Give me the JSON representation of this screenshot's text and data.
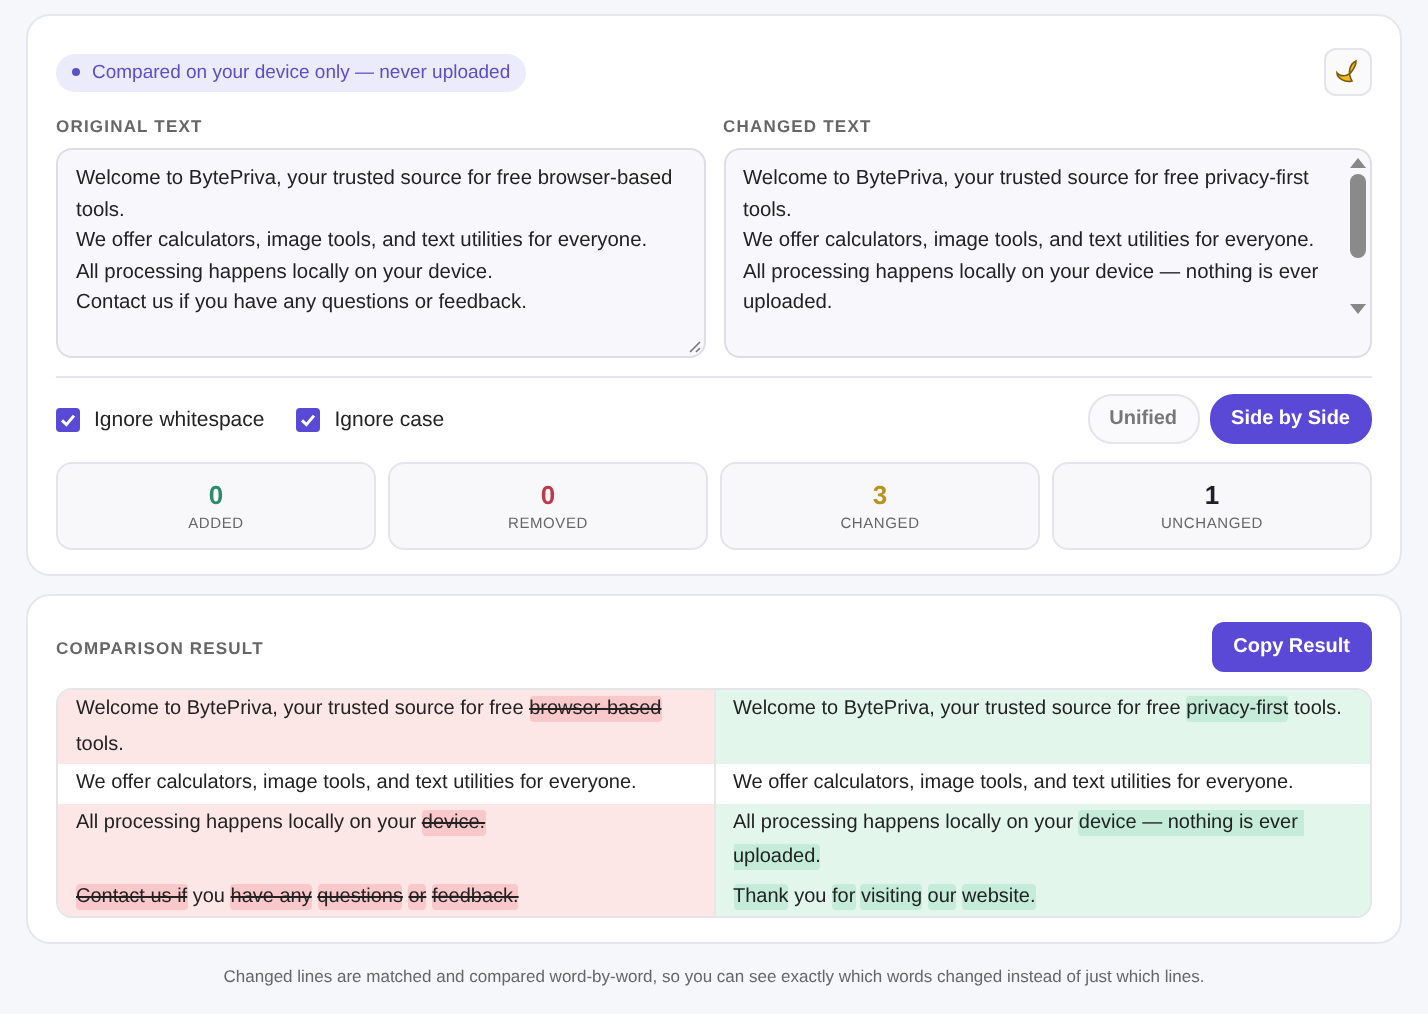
{
  "privacy_badge": "Compared on your device only — never uploaded",
  "original": {
    "label": "ORIGINAL TEXT",
    "lines": [
      "Welcome to BytePriva, your trusted source for free browser-based tools.",
      "We offer calculators, image tools, and text utilities for everyone.",
      "All processing happens locally on your device.",
      "Contact us if you have any questions or feedback."
    ]
  },
  "changed": {
    "label": "CHANGED TEXT",
    "lines": [
      "Welcome to BytePriva, your trusted source for free privacy-first tools.",
      "We offer calculators, image tools, and text utilities for everyone.",
      "All processing happens locally on your device — nothing is ever uploaded."
    ]
  },
  "options": [
    {
      "label": "Ignore whitespace",
      "checked": true
    },
    {
      "label": "Ignore case",
      "checked": true
    }
  ],
  "view_modes": [
    {
      "label": "Unified",
      "selected": false
    },
    {
      "label": "Side by Side",
      "selected": true
    }
  ],
  "stats": [
    {
      "value": "0",
      "label": "ADDED",
      "color": "#2e8b6a"
    },
    {
      "value": "0",
      "label": "REMOVED",
      "color": "#c0394a"
    },
    {
      "value": "3",
      "label": "CHANGED",
      "color": "#b8941f"
    },
    {
      "value": "1",
      "label": "UNCHANGED",
      "color": "#1f1f2a"
    }
  ],
  "result": {
    "title": "COMPARISON RESULT",
    "copy_button": "Copy Result",
    "rows": [
      {
        "changed": true,
        "left": [
          {
            "text": "Welcome to BytePriva, your trusted source for free ",
            "marked": false
          },
          {
            "text": "browser-based",
            "marked": true
          },
          {
            "text": " tools.",
            "marked": false
          }
        ],
        "right": [
          {
            "text": "Welcome to BytePriva, your trusted source for free ",
            "marked": false
          },
          {
            "text": "privacy-first",
            "marked": true
          },
          {
            "text": " tools.",
            "marked": false
          }
        ]
      },
      {
        "changed": false,
        "left": [
          {
            "text": "We offer calculators, image tools, and text utilities for everyone.",
            "marked": false
          }
        ],
        "right": [
          {
            "text": "We offer calculators, image tools, and text utilities for everyone.",
            "marked": false
          }
        ]
      },
      {
        "changed": true,
        "left": [
          {
            "text": "All processing happens locally on your ",
            "marked": false
          },
          {
            "text": "device.",
            "marked": true
          }
        ],
        "right": [
          {
            "text": "All processing happens locally on your ",
            "marked": false
          },
          {
            "text": "device — nothing is ever uploaded.",
            "marked": true
          }
        ]
      },
      {
        "changed": true,
        "left": [
          {
            "text": "Contact us if",
            "marked": true
          },
          {
            "text": " you ",
            "marked": false
          },
          {
            "text": "have any",
            "marked": true,
            "space_after": true
          },
          {
            "text": "questions",
            "marked": true,
            "space_after": true
          },
          {
            "text": "or",
            "marked": true,
            "space_after": true
          },
          {
            "text": "feedback.",
            "marked": true
          }
        ],
        "right": [
          {
            "text": "Thank",
            "marked": true
          },
          {
            "text": " you ",
            "marked": false
          },
          {
            "text": "for",
            "marked": true,
            "space_after": true
          },
          {
            "text": "visiting",
            "marked": true,
            "space_after": true
          },
          {
            "text": "our",
            "marked": true,
            "space_after": true
          },
          {
            "text": "website.",
            "marked": true
          }
        ]
      }
    ]
  },
  "footer_note": "Changed lines are matched and compared word-by-word, so you can see exactly which words changed instead of just which lines."
}
